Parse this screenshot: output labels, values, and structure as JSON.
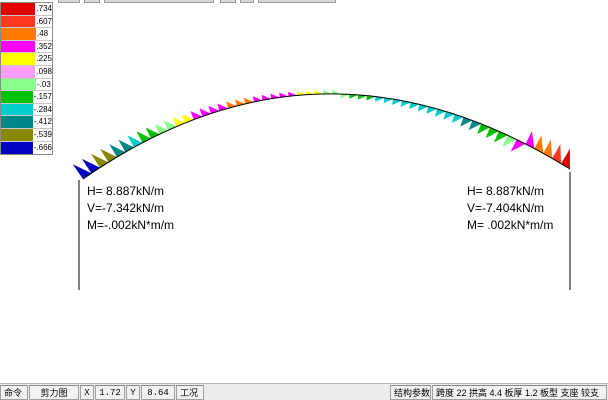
{
  "legend": {
    "items": [
      {
        "label": ".734",
        "color": "#e00000"
      },
      {
        "label": ".607",
        "color": "#ff3a20"
      },
      {
        "label": ".48",
        "color": "#ff7a00"
      },
      {
        "label": ".352",
        "color": "#ff00ff"
      },
      {
        "label": ".225",
        "color": "#ffff00"
      },
      {
        "label": ".098",
        "color": "#ff9cff"
      },
      {
        "label": "-.03",
        "color": "#88ff88"
      },
      {
        "label": "-.157",
        "color": "#00c000"
      },
      {
        "label": "-.284",
        "color": "#00cccc"
      },
      {
        "label": "-.412",
        "color": "#008888"
      },
      {
        "label": "-.539",
        "color": "#888800"
      },
      {
        "label": "-.666",
        "color": "#0000c0"
      }
    ]
  },
  "reactions": {
    "left": {
      "h": "H= 8.887kN/m",
      "v": "V=-7.342kN/m",
      "m": "M=-.002kN*m/m"
    },
    "right": {
      "h": "H= 8.887kN/m",
      "v": "V=-7.404kN/m",
      "m": "M= .002kN*m/m"
    }
  },
  "status_bar": {
    "command_label": "命令",
    "mode_label": "剪力图",
    "x_label": "X",
    "x_value": "1.72",
    "y_label": "Y",
    "y_value": "8.64",
    "workcase_label": "工况",
    "struct_params_label": "结构参数",
    "struct_params_value": "跨度 22 拱高 4.4 板厚 1.2 板型 支座 铰支"
  }
}
